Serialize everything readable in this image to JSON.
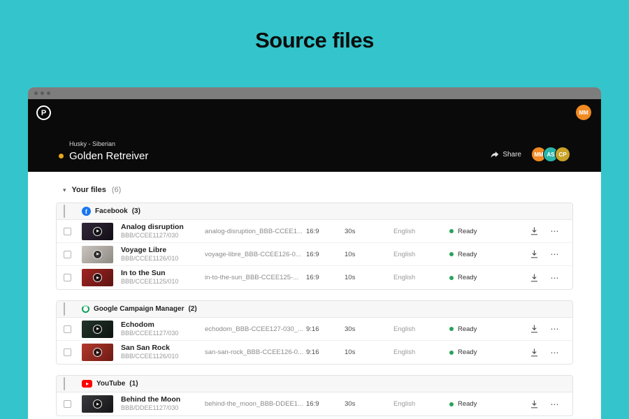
{
  "page": {
    "title": "Source files"
  },
  "colors": {
    "background": "#33c5cb",
    "ready": "#27a35a",
    "facebook": "#1877f2",
    "youtube": "#fe0000",
    "google": "#0f9d58",
    "accent_dot": "#e8a61a"
  },
  "icons": {
    "caret_down": "▾",
    "ellipsis": "⋯",
    "play": "▶"
  },
  "window": {
    "header": {
      "logo_letter": "P",
      "top_avatar": {
        "initials": "MM",
        "color": "#f18a21"
      },
      "project_label": "Husky - Siberian",
      "project_title": "Golden Retreiver",
      "share_label": "Share",
      "avatars": [
        {
          "initials": "MM",
          "color": "#f18a21"
        },
        {
          "initials": "AS",
          "color": "#2ab5ab"
        },
        {
          "initials": "CP",
          "color": "#c9a227"
        }
      ]
    },
    "files_toggle": {
      "label": "Your files",
      "count": "(6)"
    },
    "groups": [
      {
        "name": "Facebook",
        "count": "(3)",
        "icon": "facebook",
        "rows": [
          {
            "title": "Analog disruption",
            "code": "BBB/CCEE1127/030",
            "filename": "analog-disruption_BBB-CCEE1...",
            "ratio": "16:9",
            "duration": "30s",
            "language": "English",
            "status": "Ready",
            "thumb": "linear-gradient(135deg,#32283a,#120d16)"
          },
          {
            "title": "Voyage Libre",
            "code": "BBB/CCEE1126/010",
            "filename": "voyage-libre_BBB-CCEE126-0...",
            "ratio": "16:9",
            "duration": "10s",
            "language": "English",
            "status": "Ready",
            "thumb": "linear-gradient(135deg,#c9c4bd,#8e8a84)"
          },
          {
            "title": "In to the Sun",
            "code": "BBB/CCEE1125/010",
            "filename": "in-to-the-sun_BBB-CCEE125-...",
            "ratio": "16:9",
            "duration": "10s",
            "language": "English",
            "status": "Ready",
            "thumb": "linear-gradient(135deg,#a02522,#5d1412)"
          }
        ]
      },
      {
        "name": "Google Campaign Manager",
        "count": "(2)",
        "icon": "google",
        "rows": [
          {
            "title": "Echodom",
            "code": "BBB/CCEE1127/030",
            "filename": "echodom_BBB-CCEE127-030_...",
            "ratio": "9:16",
            "duration": "30s",
            "language": "English",
            "status": "Ready",
            "thumb": "linear-gradient(135deg,#22352a,#0d1410)"
          },
          {
            "title": "San San Rock",
            "code": "BBB/CCEE1126/010",
            "filename": "san-san-rock_BBB-CCEE126-0...",
            "ratio": "9:16",
            "duration": "10s",
            "language": "English",
            "status": "Ready",
            "thumb": "linear-gradient(135deg,#b4382c,#6c1a14)"
          }
        ]
      },
      {
        "name": "YouTube",
        "count": "(1)",
        "icon": "youtube",
        "rows": [
          {
            "title": "Behind the Moon",
            "code": "BBB/DDEE1127/030",
            "filename": "behind-the_moon_BBB-DDEE1...",
            "ratio": "16:9",
            "duration": "30s",
            "language": "English",
            "status": "Ready",
            "thumb": "linear-gradient(135deg,#3a3a3e,#141416)"
          }
        ]
      }
    ]
  }
}
